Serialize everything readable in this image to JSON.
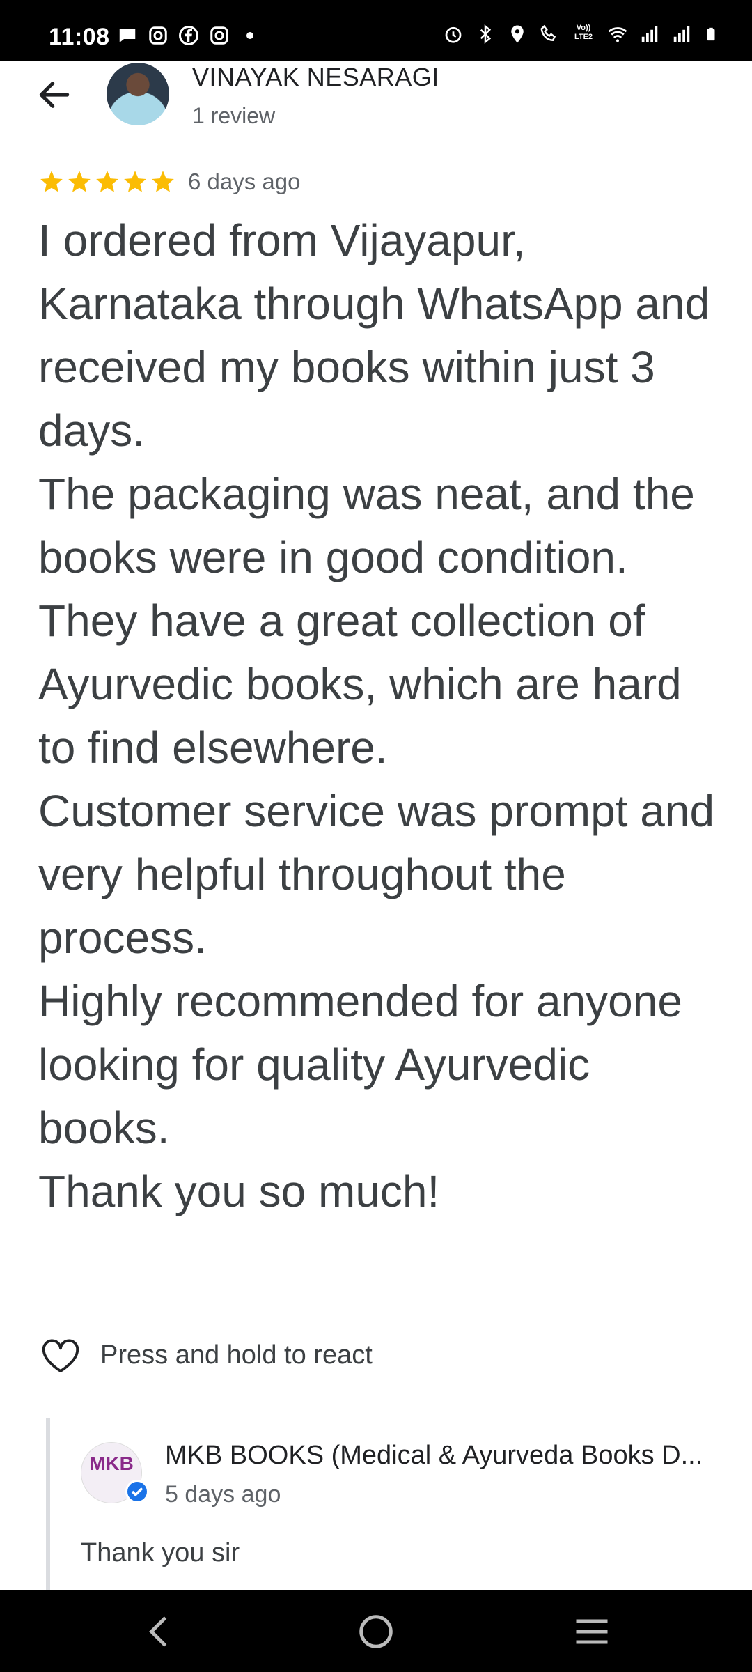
{
  "status_bar": {
    "time": "11:08",
    "left_icons": [
      "chat-bubble-icon",
      "instagram-icon",
      "facebook-icon",
      "instagram-icon",
      "dot-icon"
    ],
    "right_icons": [
      "alarm-icon",
      "bluetooth-icon",
      "location-icon",
      "wifi-calling-icon",
      "volte-icon",
      "wifi-icon",
      "signal-icon",
      "signal-icon",
      "battery-icon"
    ],
    "volte_label": "Vo)) LTE2"
  },
  "header": {
    "reviewer_name": "VINAYAK NESARAGI",
    "review_count": "1 review"
  },
  "rating": {
    "stars": 5,
    "date": "6 days ago",
    "star_color": "#fbbc04"
  },
  "review": {
    "paragraphs": [
      "I ordered from Vijayapur, Karnataka through WhatsApp and received my books within just 3 days.",
      "The packaging was neat, and the books were in good condition.",
      "They have a great collection of Ayurvedic books, which are hard to find elsewhere.",
      "Customer service was prompt and very helpful throughout the process.",
      "Highly recommended for anyone looking for quality Ayurvedic books.",
      "Thank you so much!"
    ]
  },
  "react": {
    "label": "Press and hold to react"
  },
  "owner_response": {
    "logo_text": "MKB",
    "name": "MKB BOOKS (Medical & Ayurveda Books D...",
    "date": "5 days ago",
    "reply": "Thank you sir"
  },
  "colors": {
    "verified_blue": "#1a73e8",
    "text_primary": "#202124",
    "text_secondary": "#5f6368"
  }
}
